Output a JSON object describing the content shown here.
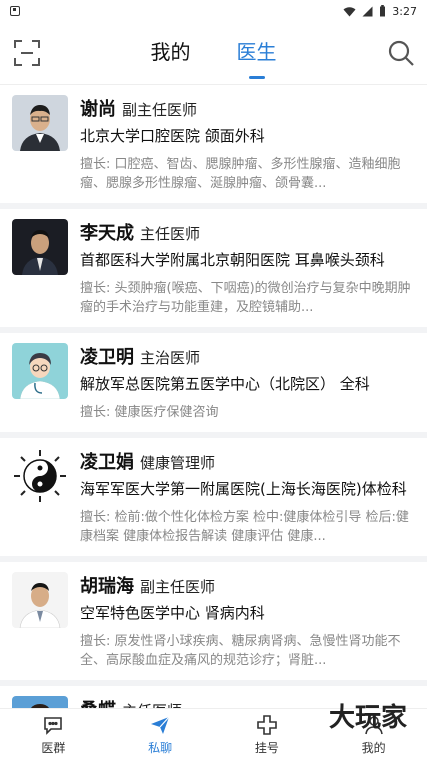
{
  "status": {
    "time": "3:27"
  },
  "header": {
    "tabs": [
      {
        "label": "我的"
      },
      {
        "label": "医生"
      }
    ]
  },
  "doctors": [
    {
      "name": "谢尚",
      "title": "副主任医师",
      "hospital": "北京大学口腔医院 颌面外科",
      "skill": "擅长: 口腔癌、智齿、腮腺肿瘤、多形性腺瘤、造釉细胞瘤、腮腺多形性腺瘤、涎腺肿瘤、颌骨囊..."
    },
    {
      "name": "李天成",
      "title": "主任医师",
      "hospital": "首都医科大学附属北京朝阳医院 耳鼻喉头颈科",
      "skill": "擅长: 头颈肿瘤(喉癌、下咽癌)的微创治疗与复杂中晚期肿瘤的手术治疗与功能重建，及腔镜辅助..."
    },
    {
      "name": "凌卫明",
      "title": "主治医师",
      "hospital": "解放军总医院第五医学中心（北院区） 全科",
      "skill": "擅长: 健康医疗保健咨询"
    },
    {
      "name": "凌卫娟",
      "title": "健康管理师",
      "hospital": "海军军医大学第一附属医院(上海长海医院)体检科",
      "skill": "擅长: 检前:做个性化体检方案 检中:健康体检引导 检后:健康档案 健康体检报告解读 健康评估 健康..."
    },
    {
      "name": "胡瑞海",
      "title": "副主任医师",
      "hospital": "空军特色医学中心 肾病内科",
      "skill": "擅长: 原发性肾小球疾病、糖尿病肾病、急慢性肾功能不全、高尿酸血症及痛风的规范诊疗；肾脏..."
    },
    {
      "name": "桑蝶",
      "title": "主任医师",
      "hospital": "",
      "skill": ""
    }
  ],
  "bottom_nav": [
    {
      "label": "医群",
      "icon": "chat-bubble-icon"
    },
    {
      "label": "私聊",
      "icon": "paper-plane-icon"
    },
    {
      "label": "挂号",
      "icon": "plus-cross-icon"
    },
    {
      "label": "我的",
      "icon": "person-icon"
    }
  ],
  "watermark": "大玩家",
  "colors": {
    "accent": "#2a7ed6"
  }
}
